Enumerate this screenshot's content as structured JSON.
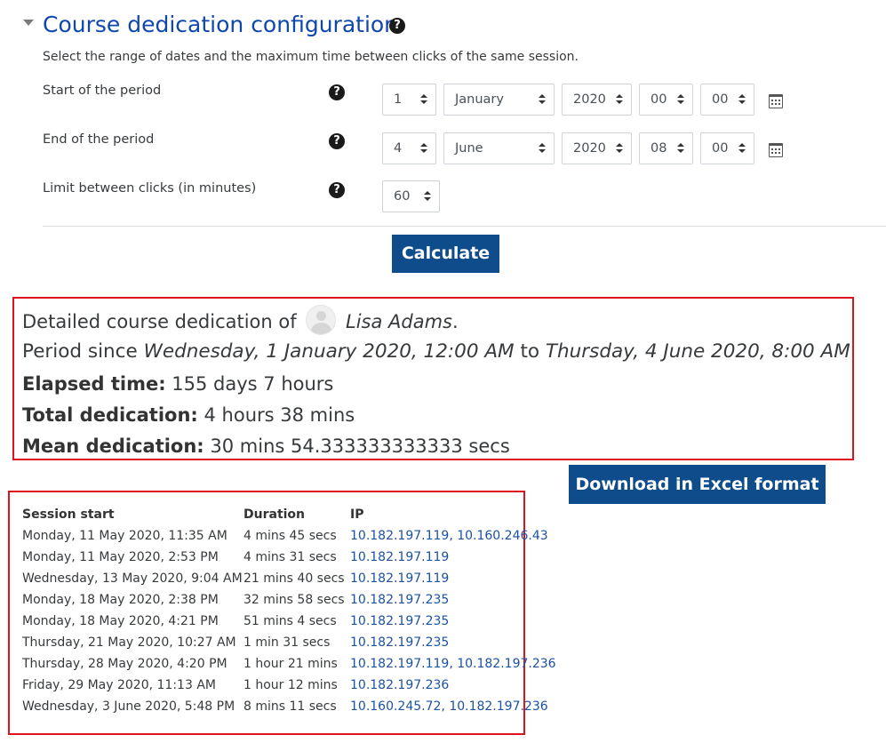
{
  "header": {
    "title": "Course dedication configuration",
    "intro": "Select the range of dates and the maximum time between clicks of the same session."
  },
  "form": {
    "start": {
      "label": "Start of the period",
      "day": "1",
      "month": "January",
      "year": "2020",
      "hour": "00",
      "minute": "00"
    },
    "end": {
      "label": "End of the period",
      "day": "4",
      "month": "June",
      "year": "2020",
      "hour": "08",
      "minute": "00"
    },
    "limit": {
      "label": "Limit between clicks (in minutes)",
      "value": "60"
    },
    "calculate_label": "Calculate"
  },
  "summary": {
    "detailed_prefix": "Detailed course dedication of",
    "user_name": "Lisa Adams",
    "period_prefix": "Period since",
    "period_start": "Wednesday, 1 January 2020, 12:00 AM",
    "period_to": "to",
    "period_end": "Thursday, 4 June 2020, 8:00 AM",
    "elapsed_label": "Elapsed time:",
    "elapsed_value": "155 days 7 hours",
    "total_label": "Total dedication:",
    "total_value": "4 hours 38 mins",
    "mean_label": "Mean dedication:",
    "mean_value": "30 mins 54.333333333333 secs"
  },
  "download_label": "Download in Excel format",
  "sessions": {
    "headers": {
      "start": "Session start",
      "duration": "Duration",
      "ip": "IP"
    },
    "rows": [
      {
        "start": "Monday, 11 May 2020, 11:35 AM",
        "duration": "4 mins 45 secs",
        "ip": "10.182.197.119, 10.160.246.43"
      },
      {
        "start": "Monday, 11 May 2020, 2:53 PM",
        "duration": "4 mins 31 secs",
        "ip": "10.182.197.119"
      },
      {
        "start": "Wednesday, 13 May 2020, 9:04 AM",
        "duration": "21 mins 40 secs",
        "ip": "10.182.197.119"
      },
      {
        "start": "Monday, 18 May 2020, 2:38 PM",
        "duration": "32 mins 58 secs",
        "ip": "10.182.197.235"
      },
      {
        "start": "Monday, 18 May 2020, 4:21 PM",
        "duration": "51 mins 4 secs",
        "ip": "10.182.197.235"
      },
      {
        "start": "Thursday, 21 May 2020, 10:27 AM",
        "duration": "1 min 31 secs",
        "ip": "10.182.197.235"
      },
      {
        "start": "Thursday, 28 May 2020, 4:20 PM",
        "duration": "1 hour 21 mins",
        "ip": "10.182.197.119, 10.182.197.236"
      },
      {
        "start": "Friday, 29 May 2020, 11:13 AM",
        "duration": "1 hour 12 mins",
        "ip": "10.182.197.236"
      },
      {
        "start": "Wednesday, 3 June 2020, 5:48 PM",
        "duration": "8 mins 11 secs",
        "ip": "10.160.245.72, 10.182.197.236"
      }
    ]
  }
}
